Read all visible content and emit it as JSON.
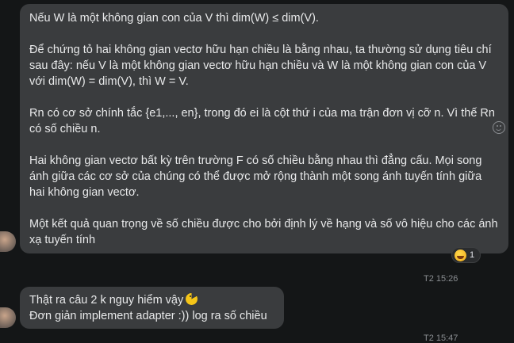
{
  "message1": {
    "paragraphs": [
      "Nếu W là một không gian con của V thì dim(W) ≤ dim(V).",
      "Để chứng tỏ hai không gian vectơ hữu hạn chiều là bằng nhau, ta thường sử dụng tiêu chí sau đây: nếu V là một không gian vectơ hữu hạn chiều và W là một không gian con của V với dim(W) = dim(V), thì W = V.",
      "Rn có cơ sở chính tắc {e1,..., en}, trong đó ei là cột thứ i của ma trận đơn vị cỡ n. Vì thế Rn có số chiều n.",
      "Hai không gian vectơ bất kỳ trên trường F có số chiều bằng nhau thì đẳng cấu. Mọi song ánh giữa các cơ sở của chúng có thể được mở rộng thành một song ánh tuyến tính giữa hai không gian vectơ.",
      "Một kết quả quan trọng về số chiều được cho bởi định lý về hạng và số vô hiệu cho các ánh xạ tuyến tính"
    ],
    "reaction": {
      "emoji": "laughing-emoji",
      "count": "1"
    },
    "timestamp": "T2 15:26"
  },
  "message2": {
    "lines": [
      "Thật ra câu 2 k nguy hiểm vậy",
      "Đơn giản implement adapter :)) log ra số chiều"
    ],
    "emoji": "pacman-emoji",
    "timestamp": "T2 15:47"
  }
}
